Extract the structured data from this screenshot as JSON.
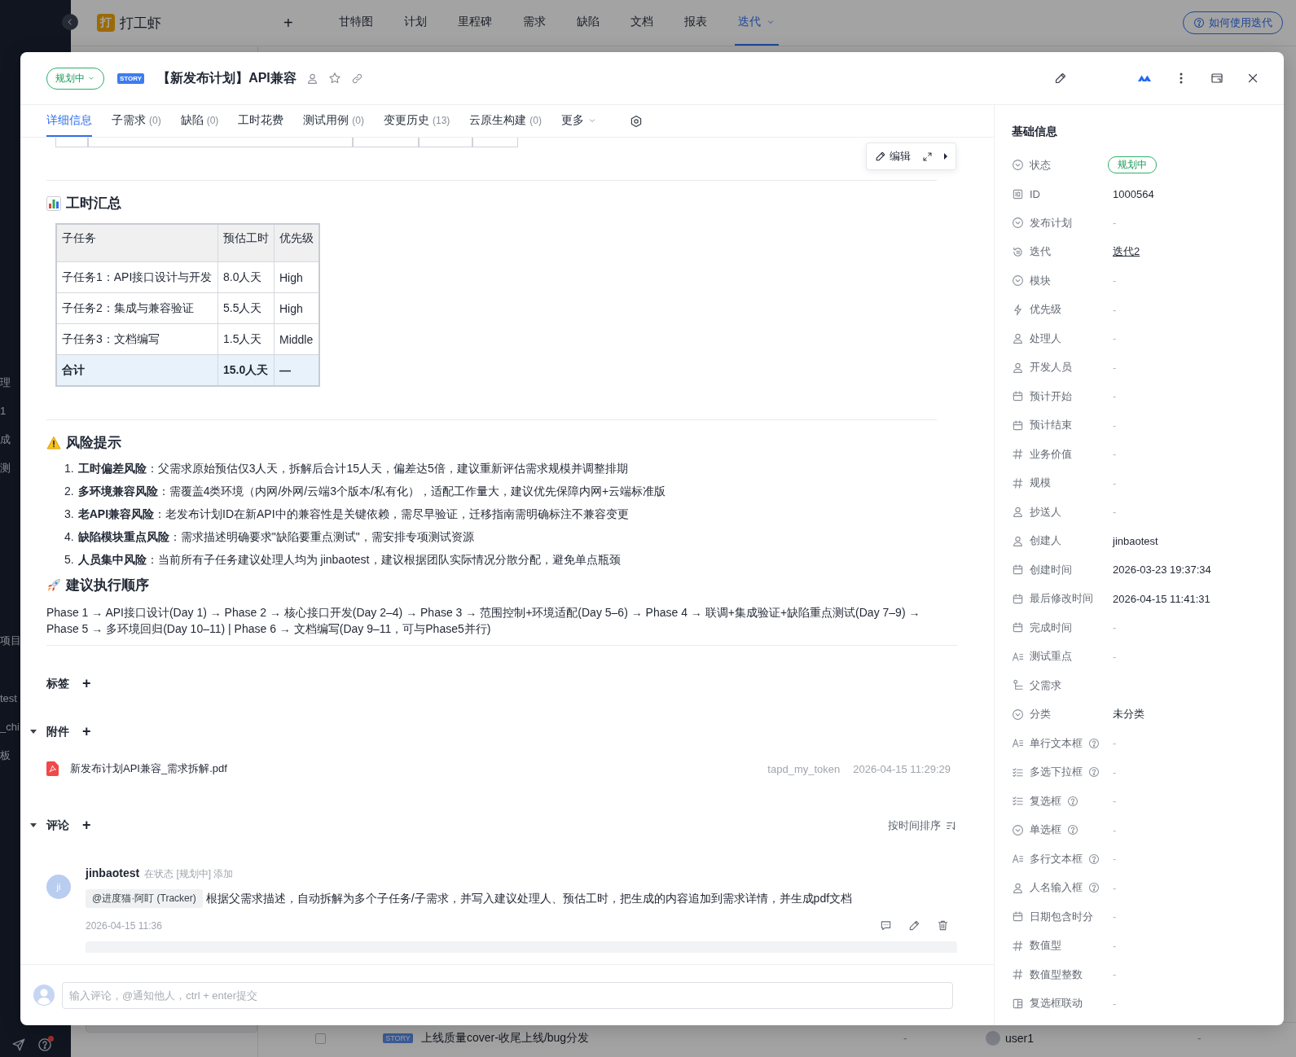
{
  "app_nav": {
    "logo_letter": "打",
    "project": "打工虾",
    "add": "+",
    "tabs": [
      {
        "label": "甘特图",
        "selected": false,
        "dropdown": false
      },
      {
        "label": "计划",
        "selected": false,
        "dropdown": false
      },
      {
        "label": "里程碑",
        "selected": false,
        "dropdown": false
      },
      {
        "label": "需求",
        "selected": false,
        "dropdown": false
      },
      {
        "label": "缺陷",
        "selected": false,
        "dropdown": false
      },
      {
        "label": "文档",
        "selected": false,
        "dropdown": false
      },
      {
        "label": "报表",
        "selected": false,
        "dropdown": false
      },
      {
        "label": "迭代",
        "selected": true,
        "dropdown": true
      }
    ],
    "help_button": "如何使用迭代"
  },
  "sidebar_groups": [
    [
      "理",
      "1",
      "成",
      "测"
    ],
    [
      "项目"
    ],
    [
      "test",
      "_chi",
      "板"
    ]
  ],
  "background_row": {
    "checked": false,
    "badge": "STORY",
    "title": "上线质量cover-收尾上线/bug分发",
    "column_3": "-",
    "user": "user1",
    "column_5": "-"
  },
  "header": {
    "status": "规划中",
    "type_badge": "STORY",
    "title": "【新发布计划】API兼容"
  },
  "tabs": [
    {
      "label": "详细信息",
      "selected": true,
      "dropdown": false
    },
    {
      "label": "子需求",
      "count": "(0)",
      "selected": false,
      "dropdown": false
    },
    {
      "label": "缺陷",
      "count": "(0)",
      "selected": false,
      "dropdown": false
    },
    {
      "label": "工时花费",
      "selected": false,
      "dropdown": false
    },
    {
      "label": "测试用例",
      "count": "(0)",
      "selected": false,
      "dropdown": false
    },
    {
      "label": "变更历史",
      "count": "(13)",
      "selected": false,
      "dropdown": false
    },
    {
      "label": "云原生构建",
      "count": "(0)",
      "selected": false,
      "dropdown": false
    },
    {
      "label": "更多",
      "selected": false,
      "dropdown": true
    }
  ],
  "content": {
    "edit_toolbar": {
      "label": "编辑"
    },
    "hours_summary": {
      "heading": "工时汇总",
      "columns": [
        "子任务",
        "预估工时",
        "优先级"
      ],
      "rows": [
        [
          "子任务1：API接口设计与开发",
          "8.0人天",
          "High"
        ],
        [
          "子任务2：集成与兼容验证",
          "5.5人天",
          "High"
        ],
        [
          "子任务3：文档编写",
          "1.5人天",
          "Middle"
        ]
      ],
      "total": [
        "合计",
        "15.0人天",
        "—"
      ]
    },
    "risks": {
      "heading": "风险提示",
      "items": [
        {
          "number": "1.",
          "text": "**工时偏差风险**：父需求原始预估仅3人天，拆解后合计15人天，偏差达5倍，建议重新评估需求规模并调整排期"
        },
        {
          "number": "2.",
          "text": "**多环境兼容风险**：需覆盖4类环境（内网/外网/云端3个版本/私有化），适配工作量大，建议优先保障内网+云端标准版"
        },
        {
          "number": "3.",
          "text": "**老API兼容风险**：老发布计划ID在新API中的兼容性是关键依赖，需尽早验证，迁移指南需明确标注不兼容变更"
        },
        {
          "number": "4.",
          "text": "**缺陷模块重点风险**：需求描述明确要求\"缺陷要重点测试\"，需安排专项测试资源"
        },
        {
          "number": "5.",
          "text": "**人员集中风险**：当前所有子任务建议处理人均为 jinbaotest，建议根据团队实际情况分散分配，避免单点瓶颈"
        }
      ]
    },
    "order": {
      "heading": "建议执行顺序",
      "text": "Phase 1 → API接口设计(Day 1) → Phase 2 → 核心接口开发(Day 2–4) → Phase 3 → 范围控制+环境适配(Day 5–6) → Phase 4 → 联调+集成验证+缺陷重点测试(Day 7–9) → Phase 5 → 多环境回归(Day 10–11) | Phase 6 → 文档编写(Day 9–11，可与Phase5并行)"
    },
    "tags": {
      "label": "标签",
      "add": "+"
    },
    "attachments": {
      "label": "附件",
      "add": "+",
      "expanded": true,
      "files": [
        {
          "name": "新发布计划API兼容_需求拆解.pdf",
          "uploader": "tapd_my_token",
          "time": "2026-04-15 11:29:29"
        }
      ]
    },
    "comments": {
      "label": "评论",
      "add": "+",
      "expanded": true,
      "sort": "按时间排序",
      "items": [
        {
          "avatar": "ji",
          "author": "jinbaotest",
          "action": "在状态 [规划中] 添加",
          "mention": "@进度猫·阿盯 (Tracker)",
          "text": "根据父需求描述，自动拆解为多个子任务/子需求，并写入建议处理人、预估工时，把生成的内容追加到需求详情，并生成pdf文档",
          "time": "2026-04-15 11:36"
        }
      ]
    },
    "comment_input": {
      "placeholder": "输入评论，@通知他人，ctrl + enter提交"
    }
  },
  "info": {
    "heading": "基础信息",
    "fields": [
      {
        "kind": "status",
        "label": "状态",
        "help": false,
        "empty": false,
        "value": "规划中"
      },
      {
        "kind": "id",
        "label": "ID",
        "help": false,
        "empty": false,
        "value": "1000564"
      },
      {
        "kind": "select",
        "label": "发布计划",
        "help": false,
        "empty": true,
        "value": "-"
      },
      {
        "kind": "iteration",
        "label": "迭代",
        "help": false,
        "empty": false,
        "value": "迭代2"
      },
      {
        "kind": "select",
        "label": "模块",
        "help": false,
        "empty": true,
        "value": "-"
      },
      {
        "kind": "priority",
        "label": "优先级",
        "help": false,
        "empty": true,
        "value": "-"
      },
      {
        "kind": "person",
        "label": "处理人",
        "help": false,
        "empty": true,
        "value": "-"
      },
      {
        "kind": "person",
        "label": "开发人员",
        "help": false,
        "empty": true,
        "value": "-"
      },
      {
        "kind": "date",
        "label": "预计开始",
        "help": false,
        "empty": true,
        "value": "-"
      },
      {
        "kind": "date",
        "label": "预计结束",
        "help": false,
        "empty": true,
        "value": "-"
      },
      {
        "kind": "number",
        "label": "业务价值",
        "help": false,
        "empty": true,
        "value": "-"
      },
      {
        "kind": "number",
        "label": "规模",
        "help": false,
        "empty": true,
        "value": "-"
      },
      {
        "kind": "person",
        "label": "抄送人",
        "help": false,
        "empty": true,
        "value": "-"
      },
      {
        "kind": "person",
        "label": "创建人",
        "help": false,
        "empty": false,
        "value": "jinbaotest"
      },
      {
        "kind": "date",
        "label": "创建时间",
        "help": false,
        "empty": false,
        "value": "2026-03-23 19:37:34"
      },
      {
        "kind": "date",
        "label": "最后修改时间",
        "help": false,
        "empty": false,
        "value": "2026-04-15 11:41:31"
      },
      {
        "kind": "date",
        "label": "完成时间",
        "help": false,
        "empty": true,
        "value": "-"
      },
      {
        "kind": "text",
        "label": "测试重点",
        "help": false,
        "empty": true,
        "value": "-"
      },
      {
        "kind": "parent",
        "label": "父需求",
        "help": false
      },
      {
        "kind": "select",
        "label": "分类",
        "help": false,
        "empty": false,
        "value": "未分类"
      },
      {
        "kind": "text",
        "label": "单行文本框",
        "help": true,
        "empty": true,
        "value": "-"
      },
      {
        "kind": "multiselect",
        "label": "多选下拉框",
        "help": true,
        "empty": true,
        "value": "-"
      },
      {
        "kind": "multiselect",
        "label": "复选框",
        "help": true,
        "empty": true,
        "value": "-"
      },
      {
        "kind": "select",
        "label": "单选框",
        "help": true,
        "empty": true,
        "value": "-"
      },
      {
        "kind": "text",
        "label": "多行文本框",
        "help": true,
        "empty": true,
        "value": "-"
      },
      {
        "kind": "person",
        "label": "人名输入框",
        "help": true,
        "empty": true,
        "value": "-"
      },
      {
        "kind": "date",
        "label": "日期包含时分",
        "help": false,
        "empty": true,
        "value": "-"
      },
      {
        "kind": "number",
        "label": "数值型",
        "help": false,
        "empty": true,
        "value": "-"
      },
      {
        "kind": "number",
        "label": "数值型整数",
        "help": false,
        "empty": true,
        "value": "-"
      },
      {
        "kind": "linkage",
        "label": "复选框联动",
        "help": false,
        "empty": true,
        "value": "-"
      }
    ]
  }
}
